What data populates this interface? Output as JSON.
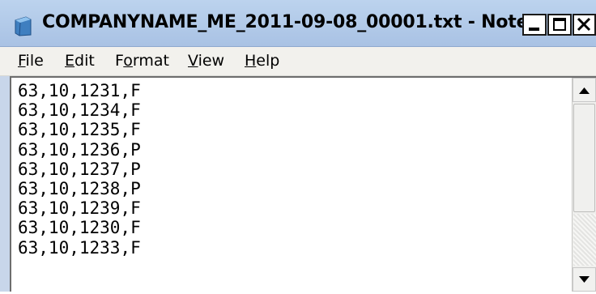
{
  "window": {
    "title": "COMPANYNAME_ME_2011-09-08_00001.txt - Note...",
    "icon": "notepad-icon"
  },
  "controls": {
    "minimize_icon": "minimize-icon",
    "maximize_icon": "maximize-icon",
    "close_icon": "close-icon"
  },
  "menu": {
    "file": {
      "mnemonic": "F",
      "rest": "ile"
    },
    "edit": {
      "mnemonic": "E",
      "rest": "dit"
    },
    "format": {
      "pre": "F",
      "mnemonic": "o",
      "rest": "rmat"
    },
    "view": {
      "mnemonic": "V",
      "rest": "iew"
    },
    "help": {
      "mnemonic": "H",
      "rest": "elp"
    }
  },
  "document": {
    "lines": [
      "63,10,1231,F",
      "63,10,1234,F",
      "63,10,1235,F",
      "63,10,1236,P",
      "63,10,1237,P",
      "63,10,1238,P",
      "63,10,1239,F",
      "63,10,1230,F",
      "63,10,1233,F"
    ]
  },
  "scrollbar": {
    "up_icon": "scroll-up-arrow-icon",
    "down_icon": "scroll-down-arrow-icon"
  }
}
